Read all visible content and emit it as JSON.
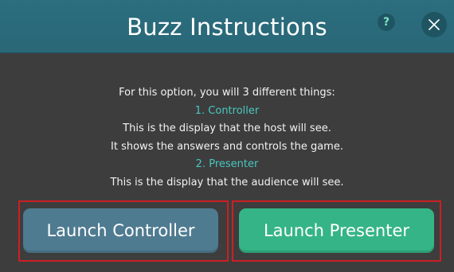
{
  "dialog": {
    "title": "Buzz Instructions",
    "help_label": "?",
    "close_label": "close"
  },
  "instructions": {
    "line1": "For this option, you will 3 different things:",
    "line2": "1. Controller",
    "line3": "This is the display that the host will see.",
    "line4": "It shows the answers and controls the game.",
    "line5": "2. Presenter",
    "line6": "This is the display that the audience will see."
  },
  "buttons": {
    "controller_label": "Launch Controller",
    "presenter_label": "Launch Presenter"
  },
  "colors": {
    "header": "#2b6e7e",
    "body": "#3d3d3d",
    "accent_text": "#49c7c0",
    "controller_button": "#4f7b91",
    "presenter_button": "#35b487",
    "highlight_border": "#cc1f26"
  },
  "icons": {
    "help": "question-mark-icon",
    "close": "close-x-icon"
  }
}
